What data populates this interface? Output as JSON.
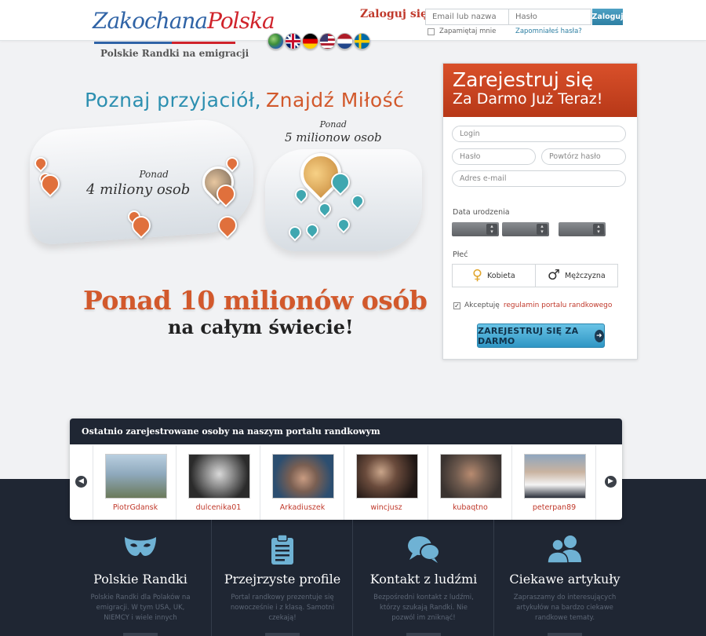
{
  "header": {
    "logo_part1": "Zakochana",
    "logo_part2": "Polska",
    "tagline": "Polskie Randki na emigracji",
    "flags": [
      "globe",
      "uk",
      "de",
      "us",
      "nl",
      "se"
    ],
    "login_title": "Zaloguj się",
    "email_placeholder": "Email lub nazwa",
    "password_placeholder": "Hasło",
    "login_button": "Zaloguj",
    "remember_label": "Zapamiętaj mnie",
    "forgot_link": "Zapomniałeś hasła?"
  },
  "hero": {
    "title_part1": "Poznaj przyjaciół,",
    "title_part2": "Znajdź Miłość",
    "usa_prefix": "Ponad",
    "usa_count": "4 miliony osob",
    "eu_prefix": "Ponad",
    "eu_count": "5 milionow osob",
    "big_line": "Ponad 10 milionów osób",
    "sub_line": "na całym świecie!"
  },
  "register": {
    "title_line1": "Zarejestruj się",
    "title_line2": "Za Darmo Już Teraz!",
    "login_placeholder": "Login",
    "password_placeholder": "Hasło",
    "repeat_password_placeholder": "Powtórz hasło",
    "email_placeholder": "Adres e-mail",
    "birthdate_label": "Data urodzenia",
    "gender_label": "Płeć",
    "female_label": "Kobieta",
    "male_label": "Mężczyzna",
    "accept_text": "Akceptuję",
    "terms_link": "regulamin portalu randkowego",
    "submit_label": "ZAREJESTRUJ SIĘ ZA DARMO"
  },
  "recent": {
    "title": "Ostatnio zarejestrowane osoby na naszym portalu randkowym",
    "users": [
      {
        "name": "PiotrGdansk",
        "photo_color": "#9bb6c9"
      },
      {
        "name": "dulcenika01",
        "photo_color": "#4a4a4a"
      },
      {
        "name": "Arkadiuszek",
        "photo_color": "#4d6c88"
      },
      {
        "name": "wincjusz",
        "photo_color": "#3a2c28"
      },
      {
        "name": "kubaqtno",
        "photo_color": "#5e5048"
      },
      {
        "name": "peterpan89",
        "photo_color": "#6f87a3"
      }
    ]
  },
  "features": [
    {
      "icon": "mask-icon",
      "title": "Polskie Randki",
      "text": "Polskie Randki dla Polaków na emigracji. W tym USA, UK, NIEMCY i wiele innych"
    },
    {
      "icon": "clipboard-icon",
      "title": "Przejrzyste profile",
      "text": "Portal randkowy prezentuje się nowocześnie i z klasą. Samotni czekają!"
    },
    {
      "icon": "chat-bubbles-icon",
      "title": "Kontakt z ludźmi",
      "text": "Bezpośredni kontakt z ludźmi, którzy szukają Randki. Nie pozwól im zniknąć!"
    },
    {
      "icon": "users-icon",
      "title": "Ciekawe artykuły",
      "text": "Zapraszamy do interesujących artykułów na bardzo ciekawe randkowe tematy."
    }
  ],
  "colors": {
    "brand_blue": "#2f63a6",
    "brand_red": "#d0232b",
    "accent_orange": "#d2592c",
    "dark_bg": "#1f2633",
    "button_blue": "#2f96c4"
  }
}
